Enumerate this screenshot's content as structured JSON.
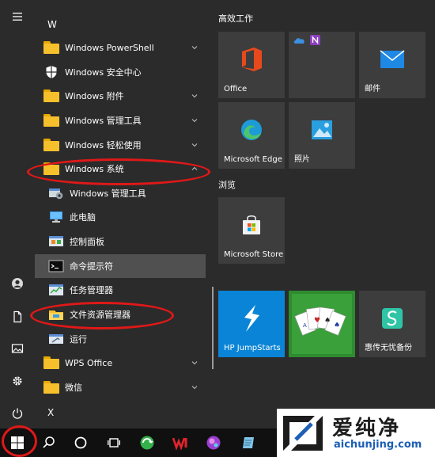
{
  "letters": {
    "w": "W",
    "x": "X"
  },
  "apps": [
    {
      "label": "Windows PowerShell",
      "icon": "folder-icon",
      "chevron": "down"
    },
    {
      "label": "Windows 安全中心",
      "icon": "shield-icon",
      "chevron": ""
    },
    {
      "label": "Windows 附件",
      "icon": "folder-icon",
      "chevron": "down"
    },
    {
      "label": "Windows 管理工具",
      "icon": "folder-icon",
      "chevron": "down"
    },
    {
      "label": "Windows 轻松使用",
      "icon": "folder-icon",
      "chevron": "down"
    },
    {
      "label": "Windows 系统",
      "icon": "folder-icon",
      "chevron": "up"
    }
  ],
  "system_items": [
    {
      "label": "Windows 管理工具",
      "icon": "admin-tools-icon"
    },
    {
      "label": "此电脑",
      "icon": "this-pc-icon"
    },
    {
      "label": "控制面板",
      "icon": "control-panel-icon"
    },
    {
      "label": "命令提示符",
      "icon": "command-prompt-icon"
    },
    {
      "label": "任务管理器",
      "icon": "task-manager-icon"
    },
    {
      "label": "文件资源管理器",
      "icon": "file-explorer-icon"
    },
    {
      "label": "运行",
      "icon": "run-icon"
    }
  ],
  "apps_after": [
    {
      "label": "WPS Office",
      "icon": "folder-icon",
      "chevron": "down"
    },
    {
      "label": "微信",
      "icon": "folder-icon",
      "chevron": "down"
    }
  ],
  "groups": {
    "productivity": "高效工作",
    "browse": "浏览"
  },
  "tiles": {
    "office": "Office",
    "mail": "邮件",
    "edge": "Microsoft Edge",
    "photos": "照片",
    "store": "Microsoft Store",
    "jumpstarts": "HP JumpStarts",
    "backup": "惠传无忧备份"
  },
  "watermark": {
    "brand": "爱纯净",
    "url": "aichunjing.com"
  },
  "colors": {
    "accent_red": "#e01818",
    "folder": "#f5c02b",
    "jumpstarts_bg": "#0a84d6",
    "solitaire_bg": "#2e8b2e"
  }
}
